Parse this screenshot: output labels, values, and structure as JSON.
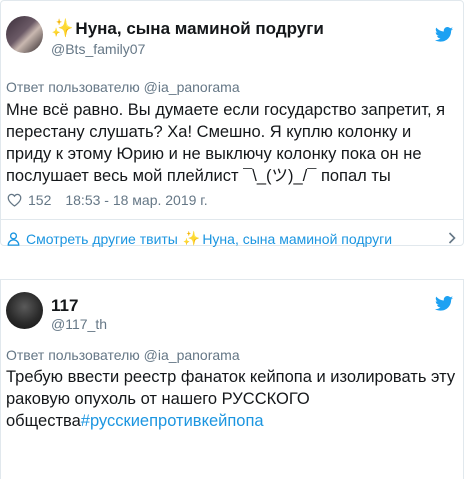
{
  "tweets": [
    {
      "name_prefix": "✨",
      "name": "Нуна, сына маминой подруги",
      "handle": "@Bts_family07",
      "reply_to": "Ответ пользователю @ia_panorama",
      "text": "Мне всё равно. Вы думаете если государство запретит, я перестану слушать? Ха! Смешно. Я куплю колонку и приду к этому Юрию и не выключу колонку пока он не послушает весь мой плейлист ¯\\_(ツ)_/¯  попал ты",
      "likes": "152",
      "timestamp": "18:53 - 18 мар. 2019 г.",
      "more_tweets_label": "Смотреть другие твиты",
      "more_tweets_prefix": "✨",
      "more_tweets_name": "Нуна, сына маминой подруги"
    },
    {
      "name": "117",
      "handle": "@117_th",
      "reply_to": "Ответ пользователю @ia_panorama",
      "text": "Требую ввести реестр фанаток кейпопа и изолировать эту раковую опухоль от нашего РУССКОГО общества",
      "hashtag": "#русскиепротивкейпопа"
    }
  ],
  "colors": {
    "link": "#1b95e0",
    "muted": "#657786",
    "text": "#14171a",
    "border": "#e1e8ed",
    "twitter_blue": "#1da1f2",
    "sparkle": "#f5b301"
  },
  "icons": [
    "twitter-bird-icon",
    "heart-icon",
    "person-icon",
    "chevron-right-icon",
    "sparkle-icon"
  ]
}
